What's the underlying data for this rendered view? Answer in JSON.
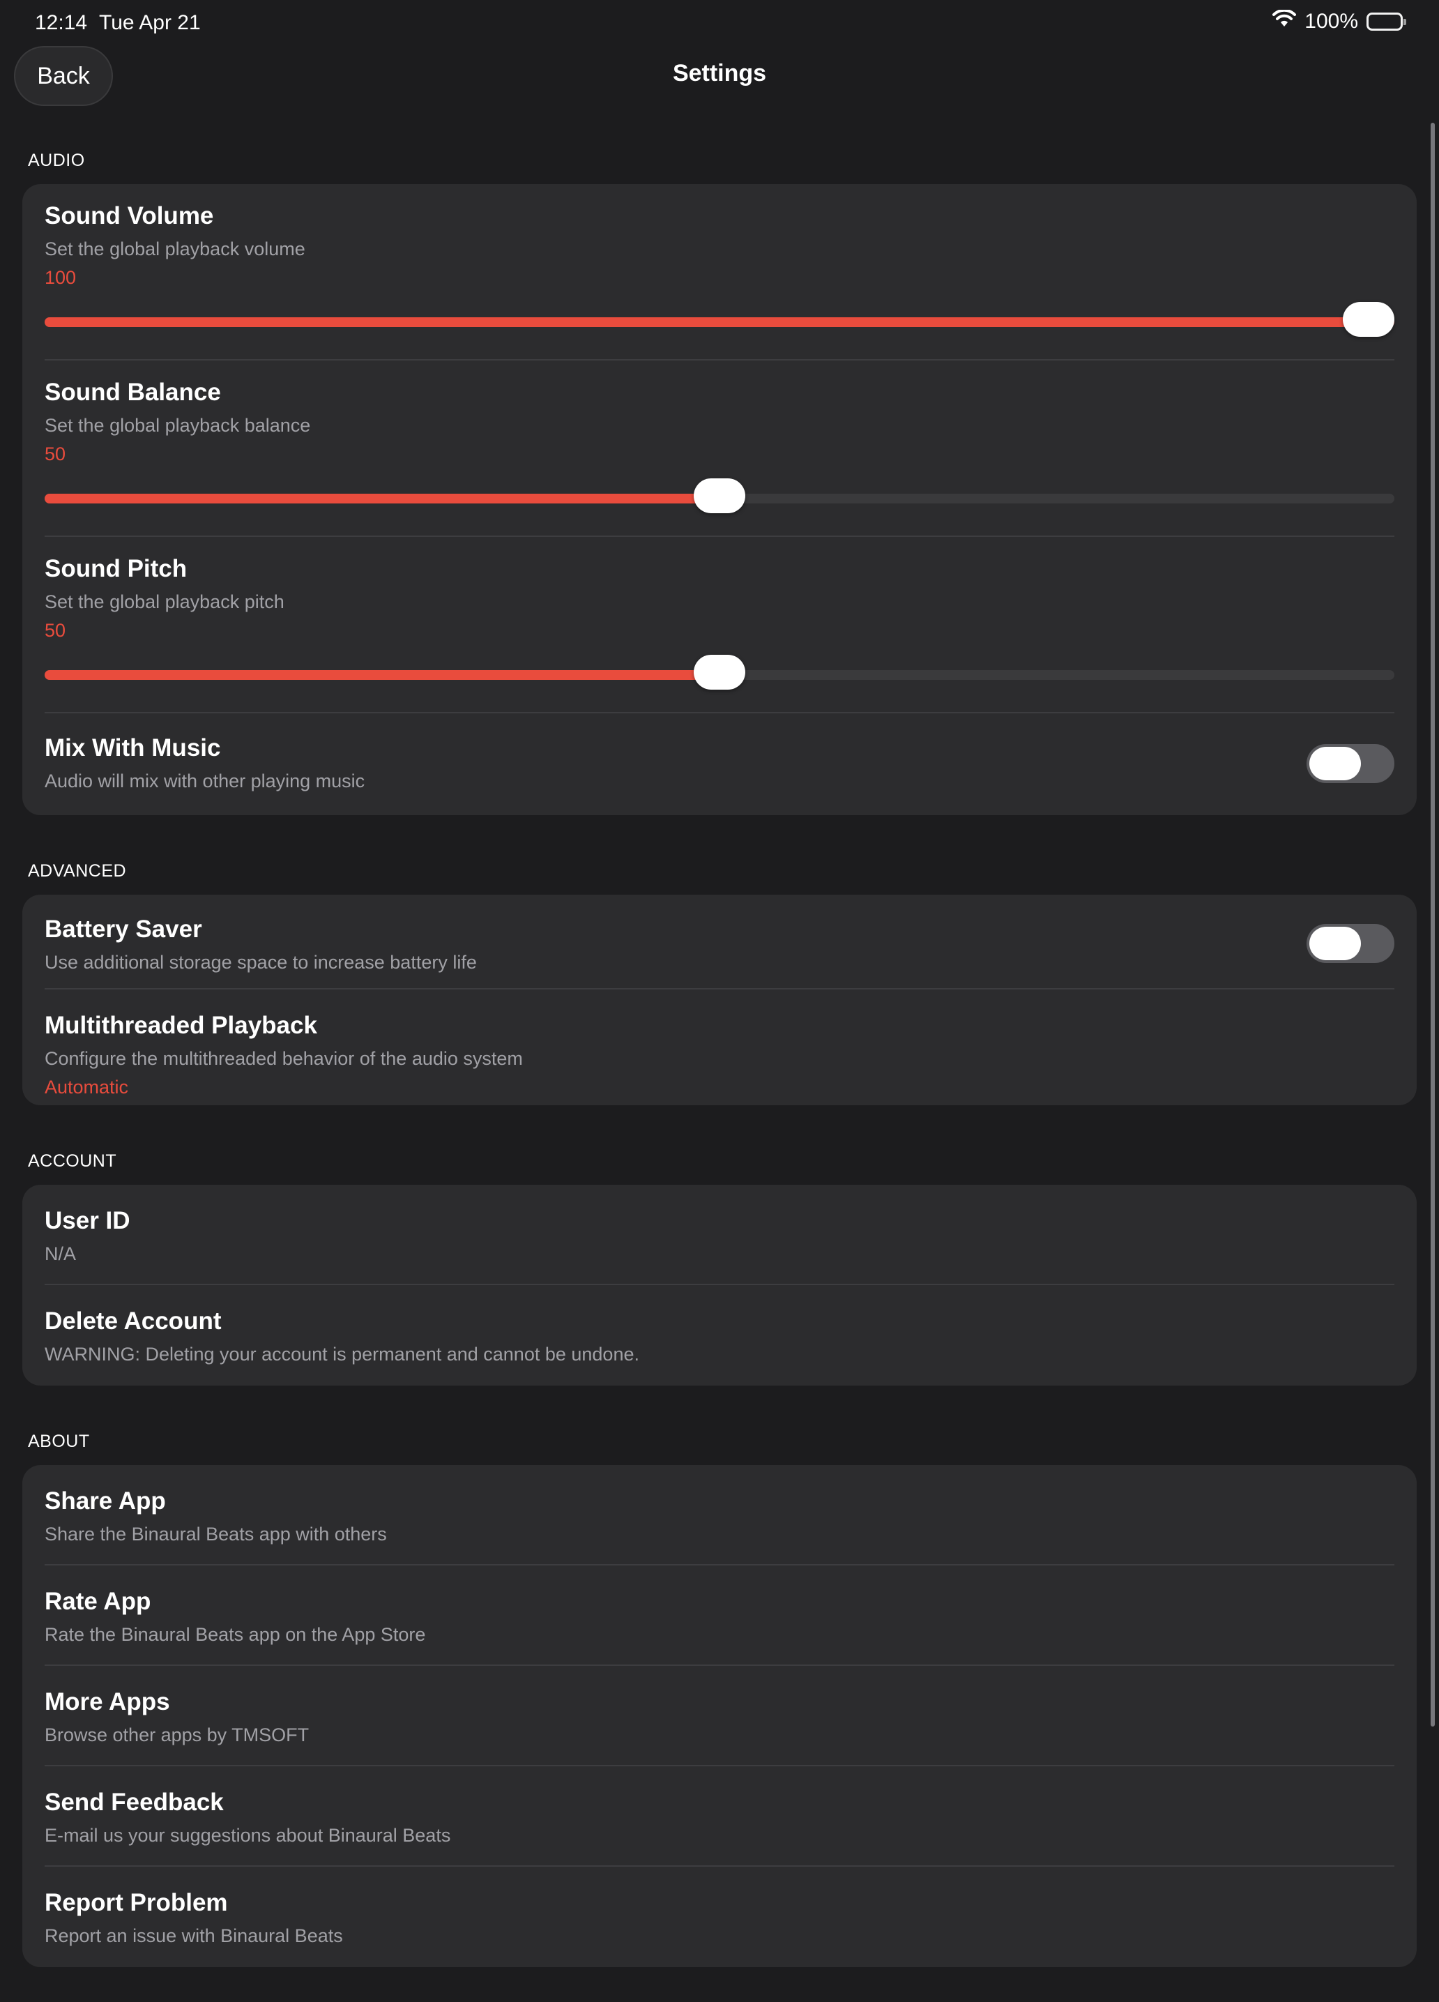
{
  "status": {
    "time": "12:14",
    "date": "Tue Apr 21",
    "battery_pct": "100%",
    "wifi_icon": "wifi-icon",
    "battery_icon": "battery-icon"
  },
  "nav": {
    "back_label": "Back",
    "title": "Settings"
  },
  "colors": {
    "accent": "#e94c3d",
    "background": "#1c1c1e",
    "card": "#2c2c2e",
    "secondary_text": "#a1a1a6"
  },
  "audio": {
    "header": "AUDIO",
    "volume": {
      "title": "Sound Volume",
      "subtitle": "Set the global playback volume",
      "value": "100",
      "fraction": 1.0
    },
    "balance": {
      "title": "Sound Balance",
      "subtitle": "Set the global playback balance",
      "value": "50",
      "fraction": 0.5
    },
    "pitch": {
      "title": "Sound Pitch",
      "subtitle": "Set the global playback pitch",
      "value": "50",
      "fraction": 0.5
    },
    "mix": {
      "title": "Mix With Music",
      "subtitle": "Audio will mix with other playing music",
      "enabled": false
    }
  },
  "advanced": {
    "header": "ADVANCED",
    "battery_saver": {
      "title": "Battery Saver",
      "subtitle": "Use additional storage space to increase battery life",
      "enabled": false
    },
    "multithreaded": {
      "title": "Multithreaded Playback",
      "subtitle": "Configure the multithreaded behavior of the audio system",
      "value": "Automatic"
    }
  },
  "account": {
    "header": "ACCOUNT",
    "user_id": {
      "title": "User ID",
      "subtitle": "N/A"
    },
    "delete": {
      "title": "Delete Account",
      "subtitle": "WARNING: Deleting your account is permanent and cannot be undone."
    }
  },
  "about": {
    "header": "ABOUT",
    "share": {
      "title": "Share App",
      "subtitle": "Share the Binaural Beats app with others"
    },
    "rate": {
      "title": "Rate App",
      "subtitle": "Rate the Binaural Beats app on the App Store"
    },
    "more": {
      "title": "More Apps",
      "subtitle": "Browse other apps by TMSOFT"
    },
    "feedback": {
      "title": "Send Feedback",
      "subtitle": "E-mail us your suggestions about Binaural Beats"
    },
    "report": {
      "title": "Report Problem",
      "subtitle": "Report an issue with Binaural Beats"
    }
  }
}
